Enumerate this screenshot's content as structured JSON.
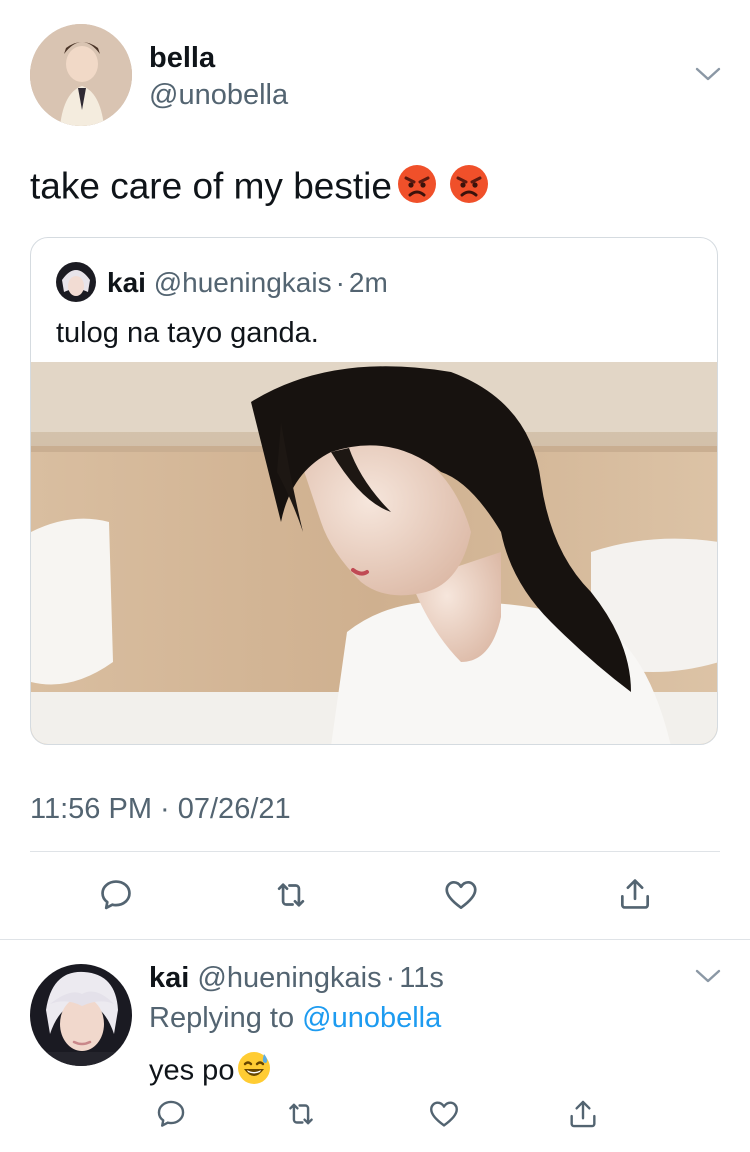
{
  "tweet": {
    "author_name": "bella",
    "author_handle": "@unobella",
    "text": "take care of my bestie",
    "emojis": [
      "angry-face",
      "angry-face"
    ],
    "timestamp": "11:56 PM · 07/26/21",
    "quoted": {
      "author_name": "kai",
      "author_handle": "@hueningkais",
      "sep": "·",
      "time": "2m",
      "text": "tulog na tayo ganda."
    }
  },
  "reply": {
    "author_name": "kai",
    "author_handle": "@hueningkais",
    "sep": "·",
    "time": "11s",
    "replying_prefix": "Replying to",
    "replying_handle": "@unobella",
    "text": "yes po",
    "emoji": "sweat-smile-face"
  },
  "icons": {
    "actions": [
      "reply-icon",
      "retweet-icon",
      "like-icon",
      "share-icon"
    ],
    "menu": "chevron-down-icon"
  },
  "colors": {
    "text": "#0f1419",
    "muted": "#536471",
    "link": "#1d9bf0",
    "divider": "#dfe3e7",
    "emoji_angry": "#f0502a"
  }
}
